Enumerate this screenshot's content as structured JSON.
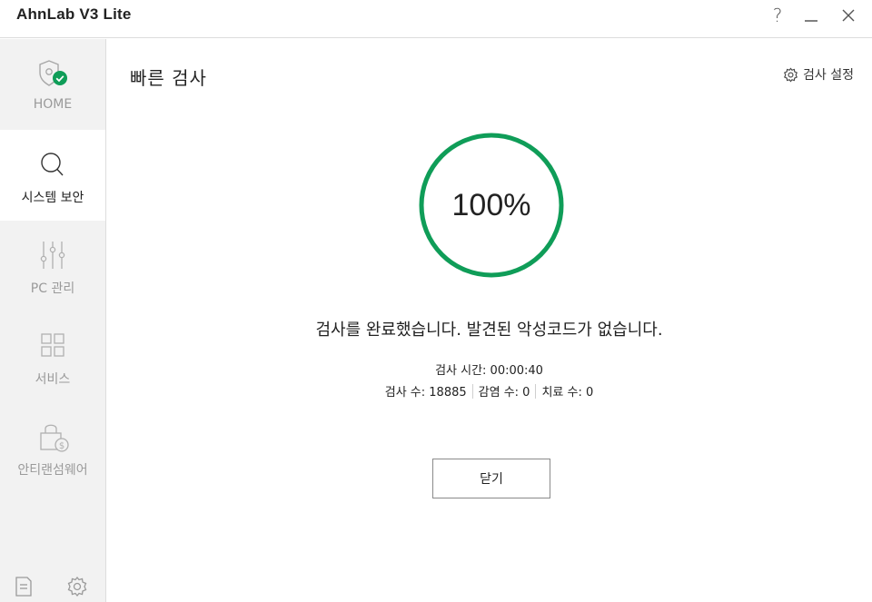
{
  "window": {
    "title": "AhnLab V3 Lite",
    "help_label": "?"
  },
  "sidebar": {
    "items": [
      {
        "label": "HOME",
        "icon": "shield-check-icon",
        "active": false
      },
      {
        "label": "시스템 보안",
        "icon": "search-icon",
        "active": true
      },
      {
        "label": "PC 관리",
        "icon": "sliders-icon",
        "active": false
      },
      {
        "label": "서비스",
        "icon": "grid-icon",
        "active": false
      },
      {
        "label": "안티랜섬웨어",
        "icon": "lock-dollar-icon",
        "active": false
      }
    ],
    "bottom_icons": [
      "document-icon",
      "gear-icon"
    ]
  },
  "main": {
    "title": "빠른 검사",
    "settings_label": "검사 설정",
    "progress": {
      "value": 100,
      "text": "100%"
    },
    "result_message": "검사를 완료했습니다. 발견된 악성코드가 없습니다.",
    "scan_time": "검사 시간: 00:00:40",
    "stats": {
      "scanned": "검사 수: 18885",
      "infected": "감염 수: 0",
      "cured": "치료 수: 0"
    },
    "close_label": "닫기"
  },
  "colors": {
    "accent_green": "#0f9d58",
    "sidebar_bg": "#f2f2f2"
  }
}
